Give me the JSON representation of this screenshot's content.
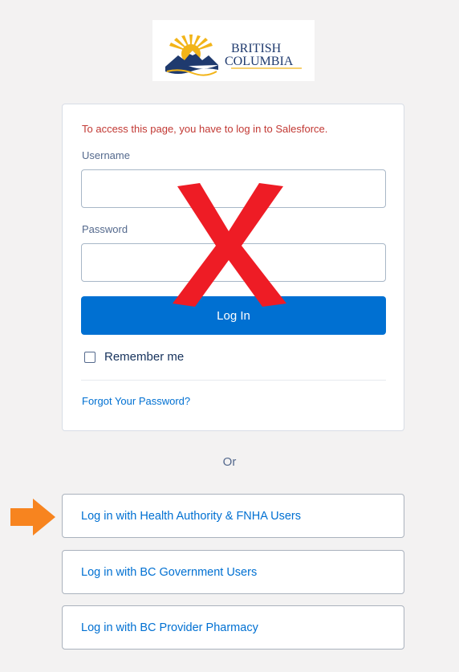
{
  "logo": {
    "line1": "BRITISH",
    "line2": "COLUMBIA"
  },
  "login": {
    "error_message": "To access this page, you have to log in to Salesforce.",
    "username_label": "Username",
    "username_value": "",
    "password_label": "Password",
    "password_value": "",
    "login_button": "Log In",
    "remember_label": "Remember me",
    "remember_checked": false,
    "forgot_link": "Forgot Your Password?"
  },
  "or_separator": "Or",
  "sso_buttons": [
    {
      "label": "Log in with Health Authority & FNHA Users"
    },
    {
      "label": "Log in with BC Government Users"
    },
    {
      "label": "Log in with BC Provider Pharmacy"
    }
  ],
  "annotations": {
    "cross_mark_color": "#ee1c25",
    "arrow_color": "#f7841f",
    "cross_mark_icon": "red-x-mark",
    "arrow_icon": "orange-arrow-right"
  },
  "colors": {
    "primary": "#0070d2",
    "error": "#c23934",
    "background": "#f3f2f2",
    "logo_gold": "#f2b418",
    "logo_blue": "#1f3a6e"
  }
}
